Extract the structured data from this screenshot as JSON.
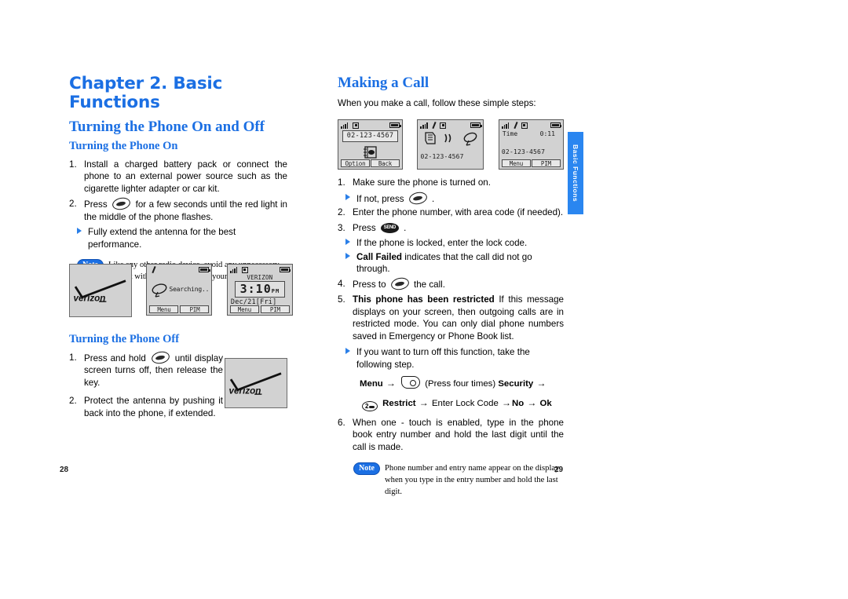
{
  "meta": {
    "accent_blue": "#1b6fe3",
    "tab_blue": "#2a86f0",
    "screen_gray": "#d2d2d2"
  },
  "side_tab": {
    "label": "Basic Functions"
  },
  "left_page": {
    "page_number": "28",
    "chapter_title": "Chapter 2. Basic Functions",
    "section_title": "Turning the Phone On and Off",
    "sub_on": {
      "title": "Turning the Phone On",
      "steps": [
        {
          "num": "1.",
          "text": "Install a charged battery pack or connect the phone to an external power source such as the cigarette lighter adapter or car kit."
        }
      ],
      "step2_pre": "Press",
      "step2_post": "for a few seconds until the red light in the middle of the phone flashes.",
      "step2_num": "2.",
      "bullet": "Fully extend the antenna for the best performance.",
      "note": {
        "badge": "Note",
        "text": "Like any other radio device, avoid any unnecessary contact with the antenna while your phone is on."
      }
    },
    "screens": [
      {
        "type": "logo",
        "logo_text": "verizon"
      },
      {
        "type": "searching",
        "status_right_battery": true,
        "body_text": "Searching..",
        "softkey_left": "Menu",
        "softkey_right": "PIM"
      },
      {
        "type": "idle",
        "operator": "VERIZON",
        "clock": "3:10",
        "clock_ampm": "PM",
        "date": "Dec/21[Fri]",
        "softkey_left": "Menu",
        "softkey_right": "PIM"
      }
    ],
    "sub_off": {
      "title": "Turning the Phone Off",
      "step1_num": "1.",
      "step1_pre": "Press and hold",
      "step1_post": "until display screen turns off, then release the key.",
      "step2_num": "2.",
      "step2_text": "Protect the antenna by pushing it back into the phone, if extended.",
      "logo_text": "verizon"
    }
  },
  "right_page": {
    "page_number": "29",
    "section_title": "Making a Call",
    "intro": "When you make a call, follow these simple steps:",
    "screens": [
      {
        "type": "dial",
        "number": "02-123-4567",
        "softkey_left": "Option",
        "softkey_right": "Back"
      },
      {
        "type": "calling",
        "number": "02-123-4567"
      },
      {
        "type": "connected",
        "time_label": "Time",
        "time_value": "0:11",
        "number": "02-123-4567",
        "softkey_left": "Menu",
        "softkey_right": "PIM"
      }
    ],
    "steps": [
      {
        "num": "1.",
        "text": "Make sure the phone is  turned on."
      },
      {
        "num": "2.",
        "text": "Enter the phone number, with area code (if needed)."
      },
      {
        "num": "3.",
        "text": "Press"
      },
      {
        "num": "4.",
        "text": "Press to"
      },
      {
        "num": "5.",
        "text": ""
      },
      {
        "num": "6.",
        "text": "When one - touch is enabled, type in the phone book entry number and hold the last digit until the call is made."
      }
    ],
    "step1_bullet_pre": "If not, press",
    "step1_bullet_post": ".",
    "step3_post": ".",
    "step3_bullets": [
      "If the phone is locked, enter the lock code.",
      "Call Failed indicates that the call did not go through."
    ],
    "step3_bullet2_bold": "Call Failed",
    "step3_bullet2_rest": " indicates that the call did not go through.",
    "step4_post": "the call.",
    "step5_bold": "This phone has been restricted",
    "step5_rest": " If this message displays on your screen, then outgoing calls are in restricted mode. You can only dial phone numbers saved in Emergency or Phone Book list.",
    "step5_bullet": "If you want to turn off this function, take the following step.",
    "menu_sequence": {
      "menu": "Menu",
      "arrow": "→",
      "press_four": "(Press four times)",
      "security": "Security",
      "restrict": "Restrict",
      "enter_lock": "Enter Lock Code",
      "no": "No",
      "ok": "Ok",
      "two_key": "2"
    },
    "note": {
      "badge": "Note",
      "text": "Phone number and entry name appear on the display when you type in the entry number and hold the last digit."
    }
  }
}
